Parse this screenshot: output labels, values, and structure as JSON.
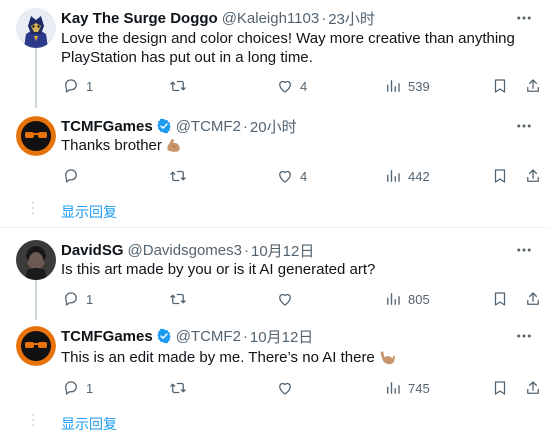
{
  "tweets": [
    {
      "name": "Kay The Surge Doggo",
      "handle": "@Kaleigh1103",
      "sep": "·",
      "time": "23小时",
      "verified": false,
      "lines": [
        "Love the design and color choices! Way more creative than anything",
        "PlayStation has put out in a long time."
      ],
      "replies": "1",
      "retweets": "",
      "likes": "4",
      "views": "539"
    },
    {
      "name": "TCMFGames",
      "handle": "@TCMF2",
      "sep": "·",
      "time": "20小时",
      "verified": true,
      "lines": [
        "Thanks brother"
      ],
      "replies": "",
      "retweets": "",
      "likes": "4",
      "views": "442"
    },
    {
      "name": "DavidSG",
      "handle": "@Davidsgomes3",
      "sep": "·",
      "time": "10月12日",
      "verified": false,
      "lines": [
        "Is this art made by you or is it AI generated art?"
      ],
      "replies": "1",
      "retweets": "",
      "likes": "",
      "views": "805"
    },
    {
      "name": "TCMFGames",
      "handle": "@TCMF2",
      "sep": "·",
      "time": "10月12日",
      "verified": true,
      "lines": [
        "This is an edit made by me. There’s no AI there"
      ],
      "replies": "1",
      "retweets": "",
      "likes": "",
      "views": "745"
    }
  ],
  "show_replies": "显示回复",
  "colors": {
    "link": "#1d9bf0",
    "muted": "#536471",
    "verified": "#1d9bf0",
    "thread": "#cfd9de"
  },
  "icons": [
    "reply-icon",
    "retweet-icon",
    "like-icon",
    "views-icon",
    "bookmark-icon",
    "share-icon",
    "more-icon",
    "verified-badge-icon",
    "flexed-biceps-emoji",
    "call-me-hand-emoji"
  ]
}
